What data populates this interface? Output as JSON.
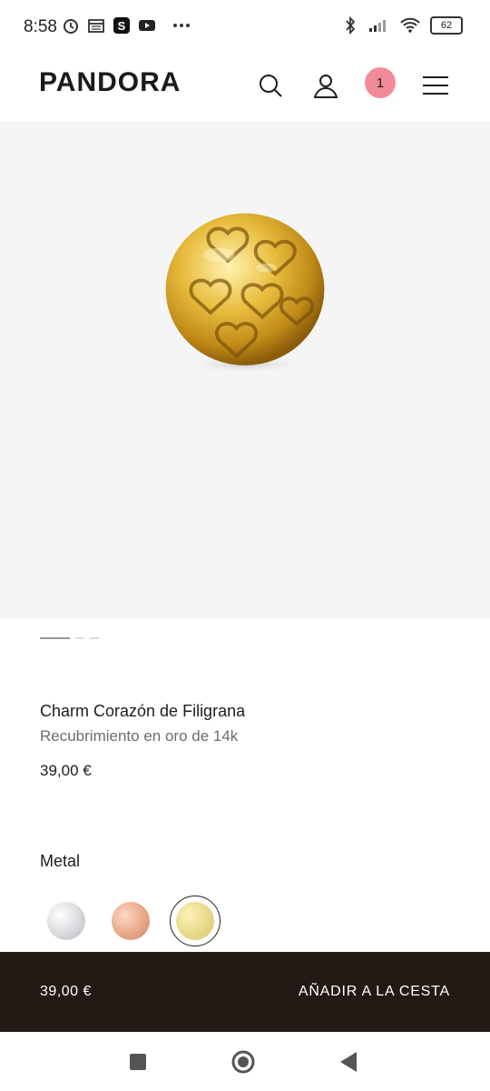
{
  "status_bar": {
    "time": "8:58",
    "battery": "62",
    "icons_left": [
      "alarm-icon",
      "calendar-icon",
      "s-app-icon",
      "youtube-icon",
      "more-dots-icon"
    ],
    "icons_right": [
      "bluetooth-icon",
      "signal-icon",
      "wifi-icon",
      "battery-icon"
    ]
  },
  "header": {
    "logo": "PANDORA",
    "cart_count": "1",
    "icons": [
      "search-icon",
      "user-icon",
      "cart-badge",
      "menu-icon"
    ]
  },
  "carousel": {
    "total": 3,
    "active_index": 0
  },
  "product": {
    "title": "Charm Corazón de Filigrana",
    "subtitle": "Recubrimiento en oro de 14k",
    "price": "39,00 €"
  },
  "metal": {
    "label": "Metal",
    "options": [
      {
        "name": "silver",
        "color": "#dcdde0"
      },
      {
        "name": "rose-gold",
        "color": "#e8a888"
      },
      {
        "name": "gold",
        "color": "#e8d98a",
        "selected": true
      }
    ]
  },
  "cta": {
    "price": "39,00 €",
    "button": "AÑADIR A LA CESTA"
  },
  "colors": {
    "accent_badge": "#f28b99",
    "cta_background": "#231a16",
    "image_bg": "#f5f5f5"
  },
  "navbar": {
    "icons": [
      "recents-square-icon",
      "home-circle-icon",
      "back-triangle-icon"
    ]
  }
}
